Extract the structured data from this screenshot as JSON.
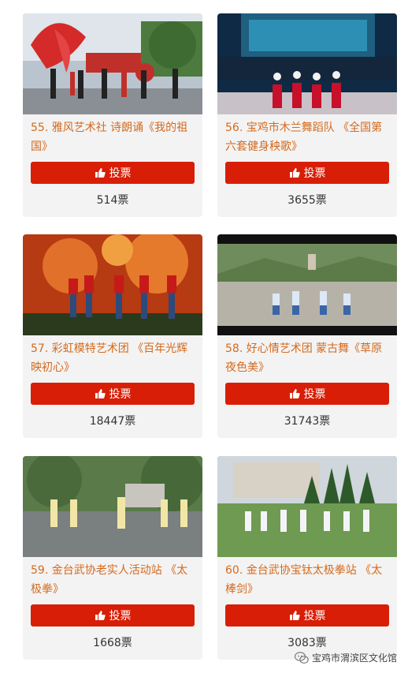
{
  "vote_label": "投票",
  "items": [
    {
      "title": "55. 雅风艺术社 诗朗诵《我的祖国》",
      "votes": "514票"
    },
    {
      "title": "56. 宝鸡市木兰舞蹈队 《全国第六套健身秧歌》",
      "votes": "3655票"
    },
    {
      "title": "57. 彩虹模特艺术团 《百年光辉映初心》",
      "votes": "18447票"
    },
    {
      "title": "58. 好心情艺术团 蒙古舞《草原夜色美》",
      "votes": "31743票"
    },
    {
      "title": "59. 金台武协老实人活动站 《太极拳》",
      "votes": "1668票"
    },
    {
      "title": "60. 金台武协宝钛太极拳站 《太棒剑》",
      "votes": "3083票"
    }
  ],
  "watermark": {
    "icon": "wechat-icon",
    "text": "宝鸡市渭滨区文化馆"
  },
  "colors": {
    "accent": "#d81e06",
    "title": "#d46a1e",
    "card_bg": "#f3f3f3"
  }
}
